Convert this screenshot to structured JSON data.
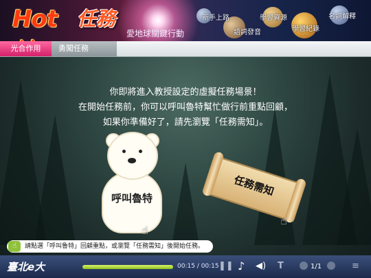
{
  "header": {
    "logo_text": "Hot 地",
    "title": "任務",
    "subtitle": "愛地球關鍵行動",
    "nav": [
      {
        "label": "新手上路"
      },
      {
        "label": "學習資源"
      },
      {
        "label": "名詞解釋"
      },
      {
        "label": "語詞發音"
      },
      {
        "label": "學習紀錄"
      }
    ]
  },
  "tabs": {
    "active": "光合作用",
    "inactive": "勇闖任務"
  },
  "main": {
    "message_lines": [
      "你即將進入教授設定的虛擬任務場景！",
      "在開始任務前，你可以呼叫魯特幫忙做行前重點回顧，",
      "如果你準備好了，請先瀏覽「任務需知」。"
    ],
    "bear_label": "呼叫魯特",
    "scroll_label": "任務需知"
  },
  "hint": {
    "text": "請點選「呼叫魯特」回顧重點，或瀏覽「任務需知」後開始任務。"
  },
  "player": {
    "logo": "臺北e大",
    "time": "00:15 / 00:15",
    "progress": 1.0,
    "page": "1/1"
  },
  "colors": {
    "accent_pink": "#e02a76",
    "progress_green": "#8ec21e"
  }
}
